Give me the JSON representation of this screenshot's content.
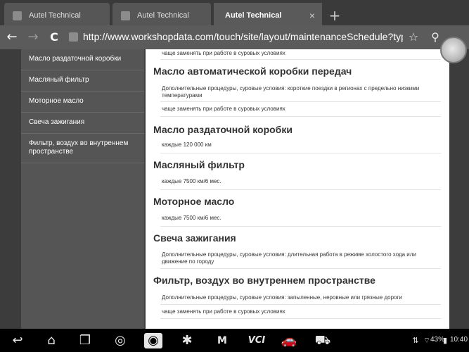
{
  "tabs": [
    {
      "label": "Autel Technical",
      "active": false
    },
    {
      "label": "Autel Technical",
      "active": false
    },
    {
      "label": "Autel Technical",
      "active": true
    }
  ],
  "tab_close_glyph": "×",
  "new_tab_glyph": "+",
  "url": "http://www.workshopdata.com/touch/site/layout/maintenanceSchedule?typeId",
  "nav": {
    "back": "←",
    "forward": "→",
    "reload": "C"
  },
  "sidebar": {
    "items": [
      {
        "label": "Масло раздаточной коробки"
      },
      {
        "label": "Масляный фильтр"
      },
      {
        "label": "Моторное масло"
      },
      {
        "label": "Свеча зажигания"
      },
      {
        "label": "Фильтр, воздух во внутреннем пространстве"
      }
    ]
  },
  "content": {
    "top_entry": "чаще заменять при работе в суровых условиях",
    "sections": [
      {
        "title": "Масло автоматической коробки передач",
        "entries": [
          "Дополнительные процедуры, суровые условия: короткие поездки в регионах с предельно низкими температурами",
          "чаще заменять при работе в суровых условиях"
        ]
      },
      {
        "title": "Масло раздаточной коробки",
        "entries": [
          "каждые 120 000 км"
        ]
      },
      {
        "title": "Масляный фильтр",
        "entries": [
          "каждые 7500 км/6 мес."
        ]
      },
      {
        "title": "Моторное масло",
        "entries": [
          "каждые 7500 км/6 мес."
        ]
      },
      {
        "title": "Свеча зажигания",
        "entries": [
          "Дополнительные процедуры, суровые условия: длительная работа в режиме холостого хода или движение по городу"
        ]
      },
      {
        "title": "Фильтр, воздух во внутреннем пространстве",
        "entries": [
          "Дополнительные процедуры, суровые условия: запыленные, неровные или грязные дороги",
          "чаще заменять при работе в суровых условиях"
        ]
      }
    ]
  },
  "systembar": {
    "battery": "43%",
    "time": "10:40",
    "vci_label": "VCI",
    "m_label": "M"
  },
  "colors": {
    "tabbar": "#3a3a3a",
    "urlbar": "#5b5b5b",
    "sidebar": "#555555",
    "content": "#ffffff"
  }
}
